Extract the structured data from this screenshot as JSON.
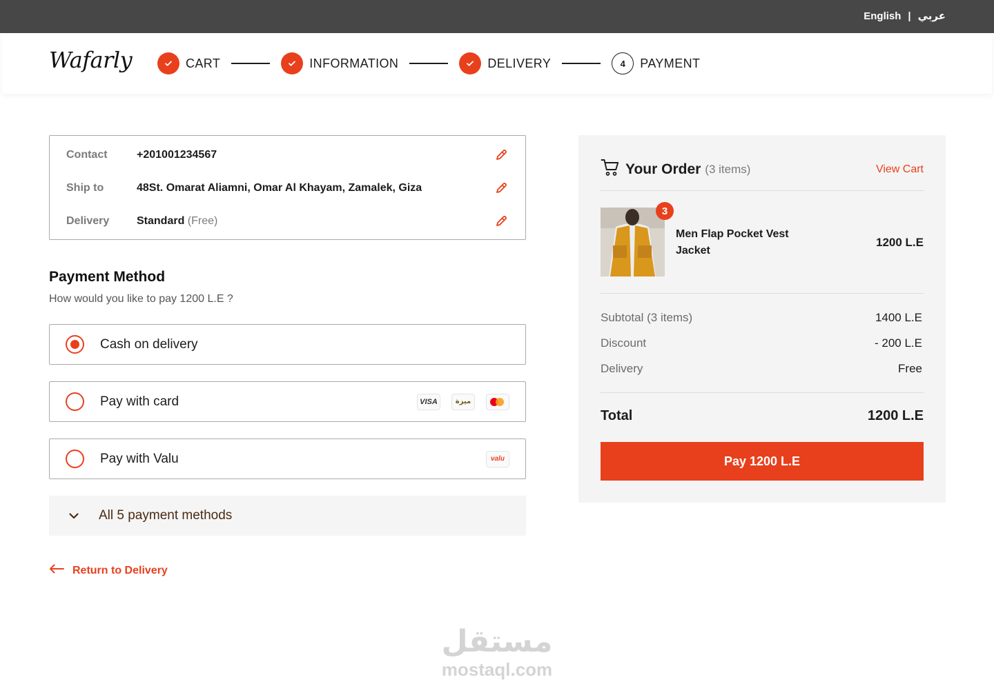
{
  "topbar": {
    "lang_en": "English",
    "separator": "|",
    "lang_ar": "عربي"
  },
  "header": {
    "logo": "Wafarly",
    "steps": [
      {
        "label": "CART",
        "state": "done"
      },
      {
        "label": "INFORMATION",
        "state": "done"
      },
      {
        "label": "DELIVERY",
        "state": "done"
      },
      {
        "label": "PAYMENT",
        "state": "current",
        "number": "4"
      }
    ]
  },
  "summary": {
    "contact": {
      "label": "Contact",
      "value": "+201001234567"
    },
    "ship_to": {
      "label": "Ship to",
      "value": "48St. Omarat Aliamni, Omar Al Khayam, Zamalek, Giza"
    },
    "delivery": {
      "label": "Delivery",
      "value": "Standard",
      "note": "(Free)"
    }
  },
  "payment": {
    "title": "Payment Method",
    "subtitle": "How would you like to pay  1200 L.E ?",
    "options": [
      {
        "label": "Cash on delivery",
        "selected": true
      },
      {
        "label": "Pay with card",
        "selected": false,
        "icons": [
          "VISA",
          "ميزة",
          "mastercard-icon"
        ]
      },
      {
        "label": "Pay with Valu",
        "selected": false,
        "icons": [
          "valu"
        ]
      }
    ],
    "all_methods_label": "All 5 payment methods",
    "return_label": "Return to Delivery"
  },
  "order": {
    "title": "Your Order",
    "count": "(3 items)",
    "view_cart": "View Cart",
    "item": {
      "name": "Men Flap Pocket Vest Jacket",
      "price": "1200 L.E",
      "quantity": "3"
    },
    "subtotal": {
      "label": "Subtotal (3 items)",
      "value": "1400 L.E"
    },
    "discount": {
      "label": "Discount",
      "value": "- 200 L.E"
    },
    "delivery": {
      "label": "Delivery",
      "value": "Free"
    },
    "total": {
      "label": "Total",
      "value": "1200 L.E"
    },
    "pay_button": "Pay 1200 L.E"
  },
  "watermark": {
    "arabic": "مستقل",
    "domain": "mostaql.com"
  },
  "colors": {
    "accent": "#e8401c",
    "topbar": "#474747",
    "panel": "#f4f4f4"
  }
}
